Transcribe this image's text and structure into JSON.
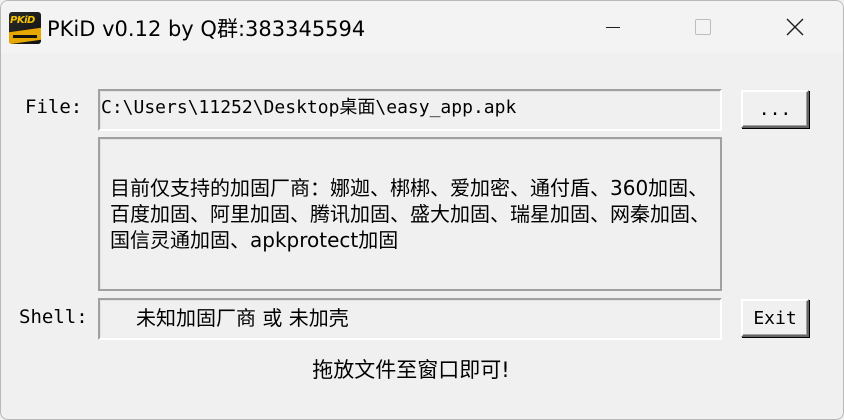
{
  "window": {
    "title": "PKiD v0.12 by Q群:383345594",
    "icon": "pkid-logo-icon",
    "icon_text": "PKiD",
    "controls": {
      "minimize_icon": "minimize-icon",
      "maximize_icon": "maximize-icon",
      "close_icon": "close-icon",
      "close_glyph": "✕"
    }
  },
  "file": {
    "label": "File:",
    "value": "C:\\Users\\11252\\Desktop桌面\\easy_app.apk",
    "browse_label": "..."
  },
  "info": {
    "text": "目前仅支持的加固厂商：娜迦、梆梆、爱加密、通付盾、360加固、百度加固、阿里加固、腾讯加固、盛大加固、瑞星加固、网秦加固、国信灵通加固、apkprotect加固"
  },
  "shell": {
    "label": "Shell:",
    "value": "未知加固厂商 或 未加壳",
    "exit_label": "Exit"
  },
  "hint": {
    "text": "拖放文件至窗口即可!"
  }
}
